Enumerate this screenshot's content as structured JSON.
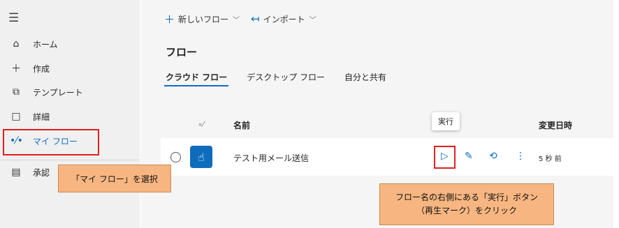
{
  "sidebar": {
    "items": [
      {
        "icon": "home-icon",
        "label": "ホーム"
      },
      {
        "icon": "plus-icon",
        "label": "作成"
      },
      {
        "icon": "template-icon",
        "label": "テンプレート"
      },
      {
        "icon": "book-icon",
        "label": "詳細"
      },
      {
        "icon": "flow-icon",
        "label": "マイ フロー"
      },
      {
        "icon": "clipboard-icon",
        "label": "承認"
      }
    ]
  },
  "toolbar": {
    "new_flow": "新しいフロー",
    "import": "インポート"
  },
  "page": {
    "title": "フロー"
  },
  "tabs": [
    "クラウド フロー",
    "デスクトップ フロー",
    "自分と共有"
  ],
  "table": {
    "headers": {
      "name": "名前",
      "modified": "変更日時"
    },
    "rows": [
      {
        "name": "テスト用メール送信",
        "modified": "5 秒 前"
      }
    ]
  },
  "tooltip": "実行",
  "annotations": {
    "callout_left": "「マイ フロー」を選択",
    "callout_right_line1": "フロー名の右側にある「実行」ボタン",
    "callout_right_line2": "（再生マーク）をクリック"
  },
  "colors": {
    "accent": "#0f6cbd",
    "highlight": "#e02020",
    "callout": "#f7b681"
  }
}
